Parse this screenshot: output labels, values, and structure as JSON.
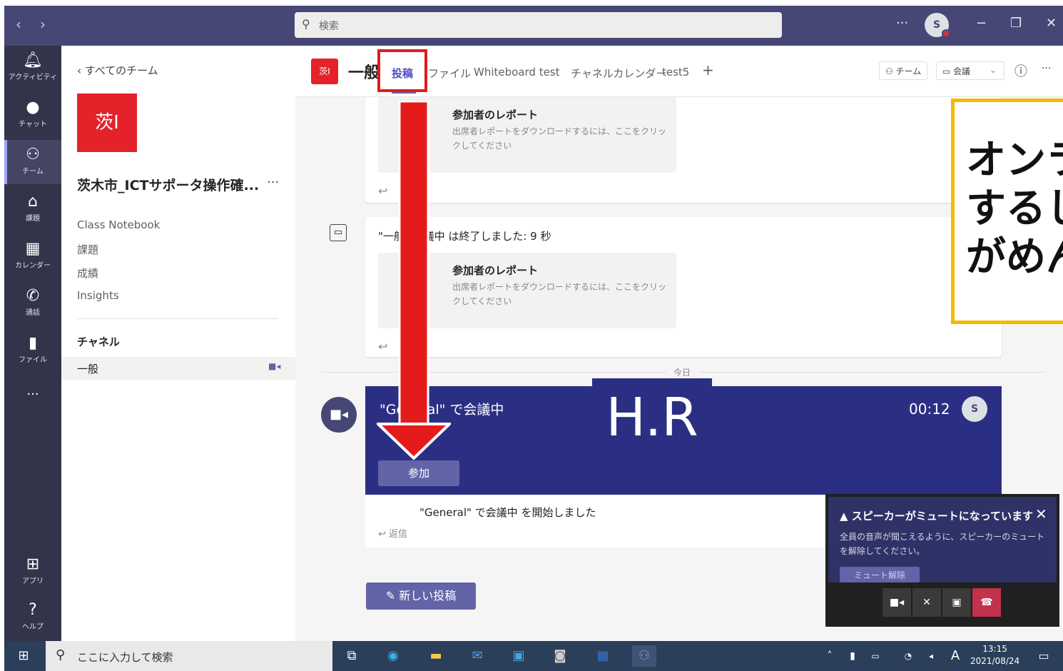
{
  "titlebar": {
    "back": "‹",
    "forward": "›",
    "search_placeholder": "検索",
    "more": "···",
    "avatar_initial": "S",
    "minimize": "−",
    "restore": "❐",
    "close": "✕"
  },
  "rail": {
    "items": [
      {
        "label": "アクティビティ",
        "icon": "bell-icon"
      },
      {
        "label": "チャット",
        "icon": "chat-icon"
      },
      {
        "label": "チーム",
        "icon": "teams-icon"
      },
      {
        "label": "課題",
        "icon": "assignments-icon"
      },
      {
        "label": "カレンダー",
        "icon": "calendar-icon"
      },
      {
        "label": "通話",
        "icon": "phone-icon"
      },
      {
        "label": "ファイル",
        "icon": "file-icon"
      }
    ],
    "more": "···",
    "apps_label": "アプリ",
    "help_label": "ヘルプ"
  },
  "sidebar": {
    "back_label": "すべてのチーム",
    "team_tile": "茨I",
    "team_name": "茨木市_ICTサポータ操作確...",
    "team_more": "···",
    "links": [
      "Class Notebook",
      "課題",
      "成績",
      "Insights"
    ],
    "channels_heading": "チャネル",
    "channel": "一般"
  },
  "header": {
    "tile": "茨I",
    "channel_name": "一般",
    "tabs": [
      "投稿",
      "ファイル",
      "Whiteboard test",
      "チャネルカレンダー",
      "test5"
    ],
    "add_tab": "+",
    "team_button": "チーム",
    "meet_button": "会議",
    "info": "ⓘ",
    "more": "···"
  },
  "messages": {
    "report_title": "参加者のレポート",
    "report_desc": "出席者レポートをダウンロードするには、ここをクリックしてください",
    "meeting_ended": "\"一般\" 会議中 は終了しました: 9 秒",
    "today": "今日"
  },
  "meeting": {
    "title": "\"General\" で会議中",
    "time": "00:12",
    "avatar_initial": "S",
    "join_label": "参加",
    "started": "\"General\" で会議中 を開始しました",
    "reply_label": "返信"
  },
  "overlay": {
    "hr_text": "H.R",
    "callout_lines": [
      "オンラ",
      "するし",
      "がめん"
    ]
  },
  "new_post_label": "新しい投稿",
  "notice": {
    "title": "スピーカーがミュートになっています",
    "body": "全員の音声が聞こえるように、スピーカーのミュートを解除してください。",
    "button": "ミュート解除"
  },
  "taskbar": {
    "search_placeholder": "ここに入力して検索",
    "time": "13:15",
    "date": "2021/08/24",
    "ime": "A"
  },
  "colors": {
    "accent": "#6264a7",
    "titlebar": "#464775",
    "meeting_banner": "#2b2f83",
    "highlight_red": "#e51a1a",
    "callout_yellow": "#f5b800"
  }
}
